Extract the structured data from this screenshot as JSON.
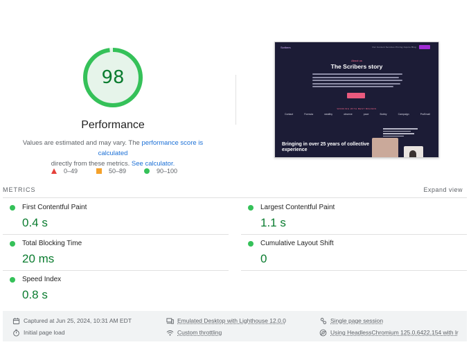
{
  "summary": {
    "score": "98",
    "score_fraction": 0.98,
    "label": "Performance",
    "description_pre": "Values are estimated and may vary. The ",
    "description_link1": "performance score is calculated",
    "description_mid": "directly from these metrics. ",
    "description_link2": "See calculator.",
    "colors": {
      "pass": "#0a7c2f",
      "pass_ring": "#35c159",
      "ring_bg": "#e6f4ea",
      "average": "#f4a12b",
      "fail": "#e5403a"
    }
  },
  "legend": [
    {
      "shape": "triangle",
      "range": "0–49"
    },
    {
      "shape": "square",
      "range": "50–89"
    },
    {
      "shape": "circle",
      "range": "90–100"
    }
  ],
  "screenshot_preview": {
    "logo": "Scribers",
    "menu": "Our Content Services     Pricing     Inquire     Blog",
    "eyebrow": "About us",
    "heading": "The Scribers story",
    "brands_heading": "WORKING WITH BEST BRANDS",
    "brands": [
      "Contact",
      "Formula",
      "wealthy",
      "observe",
      "pace",
      "Bobby",
      "Campaign",
      "ProEmail"
    ],
    "bottom_heading": "Bringing in over 25 years of collective experience"
  },
  "metrics": {
    "heading": "METRICS",
    "expand_label": "Expand view",
    "items": [
      {
        "name": "First Contentful Paint",
        "value": "0.4 s"
      },
      {
        "name": "Largest Contentful Paint",
        "value": "1.1 s"
      },
      {
        "name": "Total Blocking Time",
        "value": "20 ms"
      },
      {
        "name": "Cumulative Layout Shift",
        "value": "0"
      },
      {
        "name": "Speed Index",
        "value": "0.8 s"
      }
    ]
  },
  "footer": {
    "captured": "Captured at Jun 25, 2024, 10:31 AM EDT",
    "load": "Initial page load",
    "device": "Emulated Desktop with Lighthouse 12.0.0",
    "throttling": "Custom throttling",
    "session": "Single page session",
    "browser": "Using HeadlessChromium 125.0.6422.154 with lr"
  }
}
